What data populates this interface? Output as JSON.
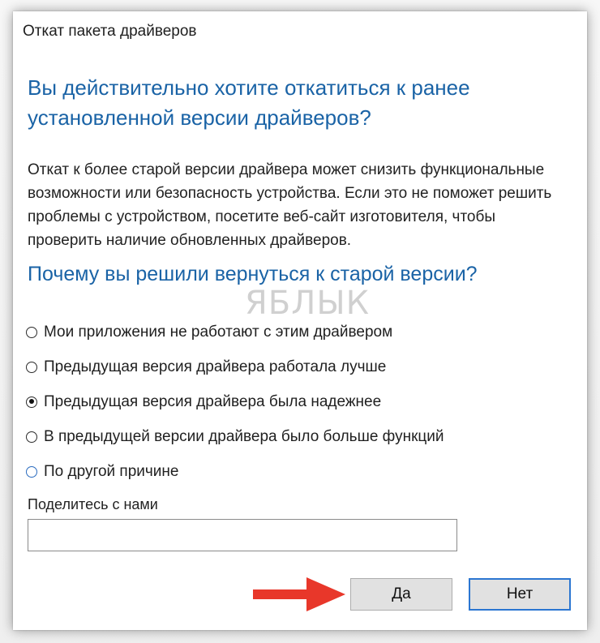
{
  "window": {
    "title": "Откат пакета драйверов"
  },
  "dialog": {
    "heading": "Вы действительно хотите откатиться к ранее установленной версии драйверов?",
    "description": "Откат к более старой версии драйвера может снизить функциональные возможности или безопасность устройства. Если это не поможет решить проблемы с устройством, посетите веб-сайт изготовителя, чтобы проверить наличие обновленных драйверов.",
    "question": "Почему вы решили вернуться к старой версии?",
    "watermark": "ЯБЛЫК",
    "reasons": [
      {
        "label": "Мои приложения не работают с этим драйвером",
        "selected": false
      },
      {
        "label": "Предыдущая версия драйвера работала лучше",
        "selected": false
      },
      {
        "label": "Предыдущая версия драйвера была надежнее",
        "selected": true
      },
      {
        "label": "В предыдущей версии драйвера было больше функций",
        "selected": false
      },
      {
        "label": "По другой причине",
        "selected": false
      }
    ],
    "share_label": "Поделитесь с нами",
    "share_value": "",
    "yes_label": "Да",
    "no_label": "Нет"
  },
  "colors": {
    "heading": "#1a63a6",
    "arrow": "#e8372a",
    "default_button_border": "#2b76d1"
  }
}
